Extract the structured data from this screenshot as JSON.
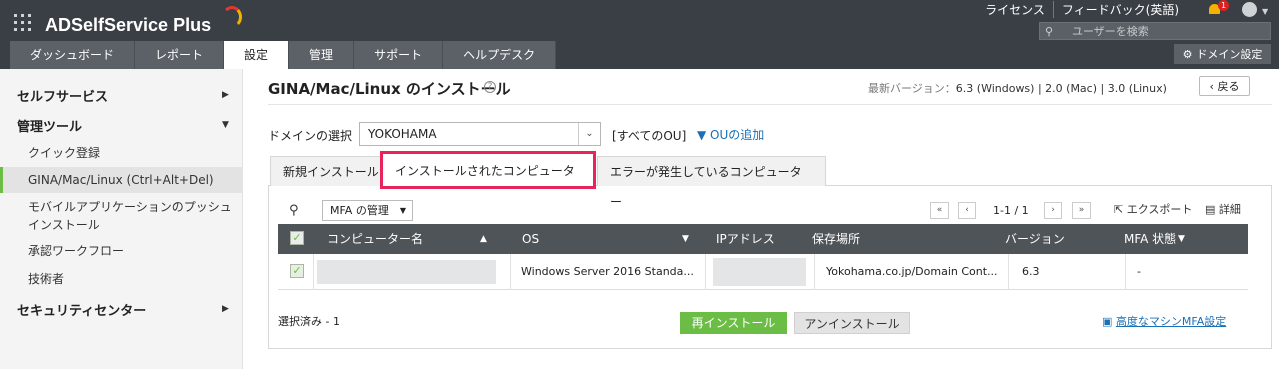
{
  "app": {
    "title": "ADSelfService Plus",
    "brand_colors": {
      "arc1": "#e03a2f",
      "arc2": "#f2b300"
    }
  },
  "top_links": {
    "license": "ライセンス",
    "feedback": "フィードバック(英語)"
  },
  "notifications": {
    "count": "1"
  },
  "search": {
    "placeholder": "ユーザーを検索"
  },
  "nav_tabs": [
    {
      "label": "ダッシュボード"
    },
    {
      "label": "レポート"
    },
    {
      "label": "設定"
    },
    {
      "label": "管理"
    },
    {
      "label": "サポート"
    },
    {
      "label": "ヘルプデスク"
    }
  ],
  "domain_settings": {
    "label": "ドメイン設定"
  },
  "sidebar": {
    "self_service": "セルフサービス",
    "admin_tools": "管理ツール",
    "items": [
      "クイック登録",
      "GINA/Mac/Linux (Ctrl+Alt+Del)",
      "モバイルアプリケーションのプッシュインストール",
      "承認ワークフロー",
      "技術者"
    ],
    "security_center": "セキュリティセンター"
  },
  "page": {
    "title": "GINA/Mac/Linux のインストール",
    "version_label": "最新バージョン：",
    "version_value": "6.3 (Windows) | 2.0 (Mac) | 3.0 (Linux)",
    "back": "戻る"
  },
  "domain": {
    "label": "ドメインの選択",
    "selected": "YOKOHAMA",
    "all_ou": "[すべてのOU]",
    "add_ou": "OUの追加"
  },
  "panel_tabs": [
    "新規インストール",
    "インストールされたコンピューター",
    "エラーが発生しているコンピューター"
  ],
  "toolbar": {
    "mfa_manage": "MFA の管理",
    "page_info": "1-1 / 1",
    "export": "エクスポート",
    "detail": "詳細"
  },
  "table": {
    "headers": {
      "computer": "コンピューター名",
      "os": "OS",
      "ip": "IPアドレス",
      "location": "保存場所",
      "version": "バージョン",
      "mfa": "MFA 状態"
    },
    "rows": [
      {
        "os": "Windows Server 2016 Standa...",
        "location": "Yokohama.co.jp/Domain Cont...",
        "version": "6.3",
        "mfa": "-"
      }
    ]
  },
  "footer": {
    "selected": "選択済み - 1",
    "reinstall": "再インストール",
    "uninstall": "アンインストール",
    "advanced_mfa": "高度なマシンMFA設定"
  }
}
